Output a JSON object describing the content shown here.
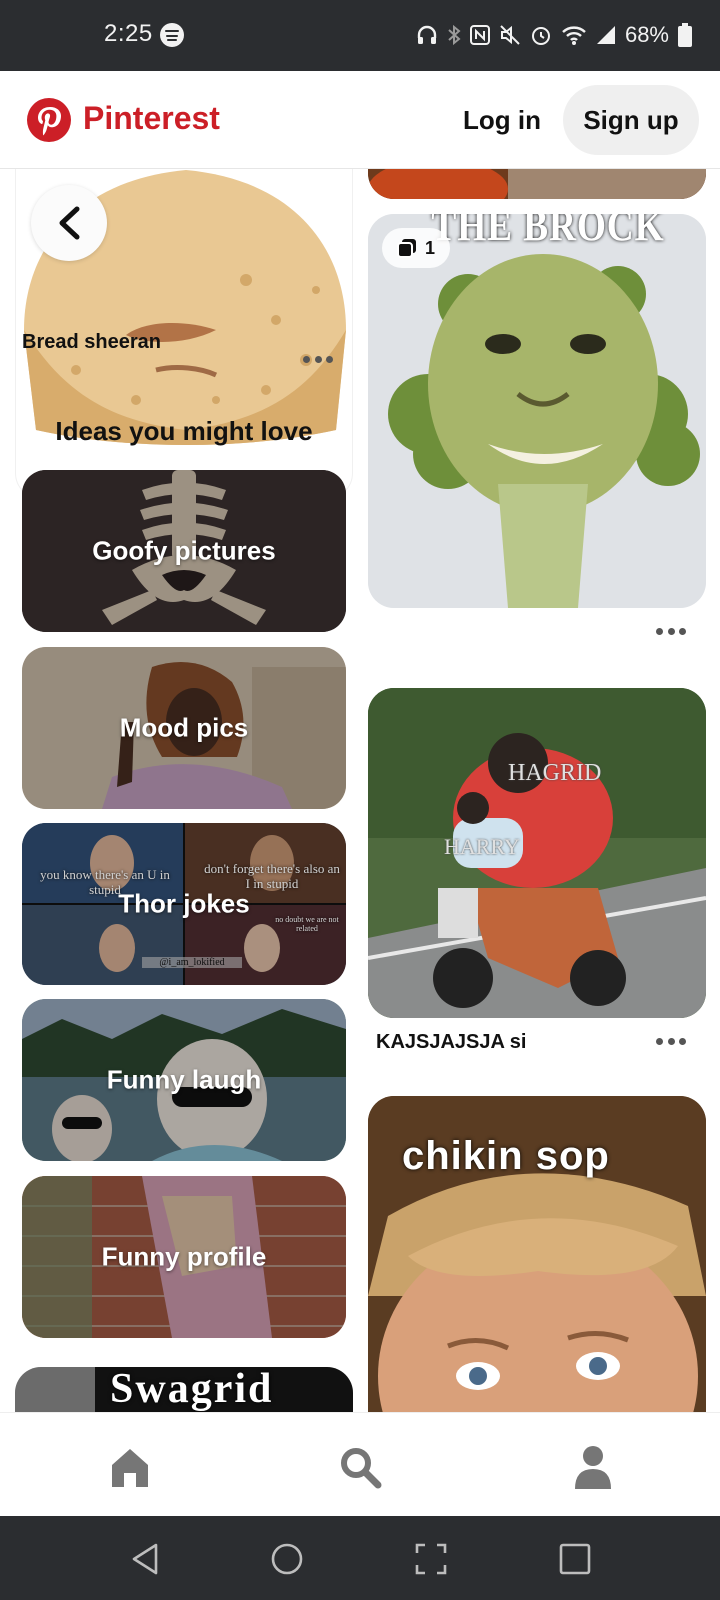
{
  "status_bar": {
    "time": "2:25",
    "battery": "68%",
    "icons": [
      "spotify-icon",
      "headphones-icon",
      "bluetooth-icon",
      "nfc-icon",
      "mute-icon",
      "alarm-icon",
      "wifi-icon",
      "signal-icon",
      "battery-icon"
    ]
  },
  "header": {
    "brand": "Pinterest",
    "login_label": "Log in",
    "signup_label": "Sign up",
    "brand_color": "#cc1f27"
  },
  "left_column": {
    "top_pin": {
      "title": "Bread sheeran"
    },
    "ideas_heading": "Ideas you might love",
    "ideas": [
      {
        "label": "Goofy pictures"
      },
      {
        "label": "Mood pics"
      },
      {
        "label": "Thor jokes",
        "overlay_texts": [
          "you know there's an U in stupid",
          "don't forget there's also an I in stupid",
          "no doubt we are not related",
          "@i_am_lokified"
        ]
      },
      {
        "label": "Funny laugh"
      },
      {
        "label": "Funny profile"
      }
    ],
    "partial_pin_text": "Swagrid"
  },
  "right_column": {
    "brock_pin": {
      "caption": "THE BROCK",
      "badge_count": "1"
    },
    "hagrid_pin": {
      "title": "KAJSJAJSJA si",
      "labels": [
        "HAGRID",
        "HARRY"
      ]
    },
    "chikin_pin": {
      "caption": "chikin sop"
    }
  },
  "bottom_nav": {
    "items": [
      "home-icon",
      "search-icon",
      "profile-icon"
    ]
  },
  "system_nav": {
    "items": [
      "back",
      "home",
      "screenshot",
      "recents"
    ]
  }
}
